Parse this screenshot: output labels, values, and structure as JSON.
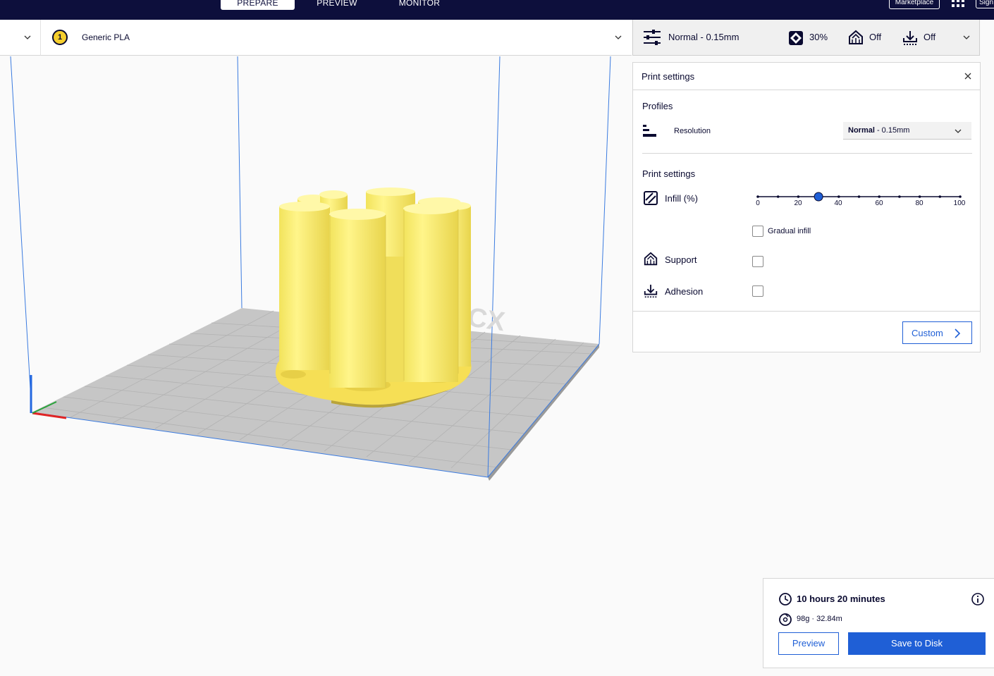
{
  "header": {
    "stages": [
      "PREPARE",
      "PREVIEW",
      "MONITOR"
    ],
    "active_stage": "PREPARE",
    "marketplace_label": "Marketplace",
    "sign_in_label": "Sign in"
  },
  "toolbar": {
    "extruder_number": "1",
    "material_name": "Generic PLA",
    "extruder_color": "#f6cf2e",
    "profile_summary": "Normal - 0.15mm",
    "infill_summary": "30%",
    "support_summary": "Off",
    "adhesion_summary": "Off"
  },
  "print_settings": {
    "title": "Print settings",
    "profiles_heading": "Profiles",
    "resolution_label": "Resolution",
    "resolution_value_bold": "Normal",
    "resolution_value_rest": " - 0.15mm",
    "settings_heading": "Print settings",
    "infill_label": "Infill (%)",
    "infill_value": 30,
    "infill_ticks": [
      "0",
      "20",
      "40",
      "60",
      "80",
      "100"
    ],
    "gradual_infill_label": "Gradual infill",
    "gradual_infill_checked": false,
    "support_label": "Support",
    "support_checked": false,
    "adhesion_label": "Adhesion",
    "adhesion_checked": false,
    "custom_button": "Custom"
  },
  "estimate": {
    "time": "10 hours 20 minutes",
    "material": "98g · 32.84m",
    "preview_button": "Preview",
    "save_button": "Save to Disk"
  },
  "colors": {
    "header_bg": "#0d0f3c",
    "accent_blue": "#1f5fd6",
    "model_yellow": "#fff36e",
    "build_plate_grey": "#c4c4c4"
  }
}
